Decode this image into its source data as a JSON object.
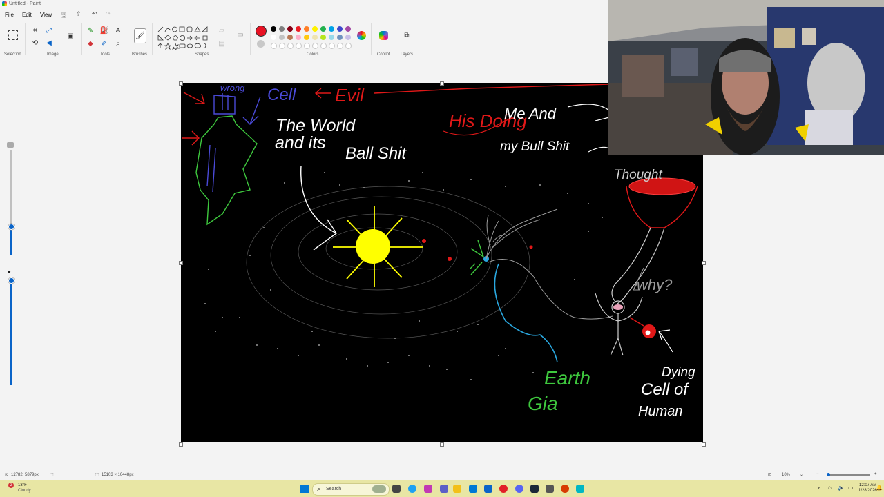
{
  "window": {
    "title": "Untitled - Paint"
  },
  "menu": {
    "file": "File",
    "edit": "Edit",
    "view": "View"
  },
  "ribbon": {
    "groups": {
      "selection": "Selection",
      "image": "Image",
      "tools": "Tools",
      "brushes": "Brushes",
      "shapes": "Shapes",
      "colors": "Colors",
      "copilot": "Copilot",
      "layers": "Layers"
    },
    "tool_icons": [
      "pencil-icon",
      "fill-icon",
      "text-icon",
      "eraser-icon",
      "color-picker-icon",
      "magnifier-icon"
    ],
    "primary_color": "#e81123",
    "secondary_color": "#c8c8c8",
    "palette_row1": [
      "#000000",
      "#7f7f7f",
      "#880015",
      "#ed1c24",
      "#ff7f27",
      "#fff200",
      "#22b14c",
      "#00a2e8",
      "#3f48cc",
      "#a349a4"
    ],
    "palette_row2": [
      "#ffffff",
      "#c3c3c3",
      "#b97a57",
      "#ffaec9",
      "#ffc90e",
      "#efe4b0",
      "#b5e61d",
      "#99d9ea",
      "#7092be",
      "#c8bfe7"
    ]
  },
  "drawing": {
    "labels": {
      "wrong": "wrong",
      "cell": "Cell",
      "evil": "Evil",
      "his_doing": "His Doing",
      "me_and": "Me And",
      "my_bull_shit": "my Bull Shit",
      "the_world": "The World",
      "and_its": "and its",
      "ball_shit": "Ball Shit",
      "thought": "Thought",
      "why": "why?",
      "earth": "Earth",
      "gia": "Gia",
      "dying": "Dying",
      "cell_of": "Cell of",
      "human": "Human"
    },
    "colors": {
      "background": "#000000",
      "sun": "#ffff00",
      "blue": "#4a4ad8",
      "green": "#3ec83e",
      "red": "#e01818",
      "cyan": "#2aa8e0",
      "grey": "#9a9a9a",
      "white": "#ffffff"
    }
  },
  "status": {
    "cursor_pos": "12782, 5879px",
    "canvas_size": "15103 × 10448px",
    "zoom": "10%"
  },
  "taskbar": {
    "weather_temp": "13°F",
    "weather_desc": "Cloudy",
    "weather_badge": "2",
    "search_placeholder": "Search",
    "time": "12:07 AM",
    "date": "1/28/2026"
  }
}
